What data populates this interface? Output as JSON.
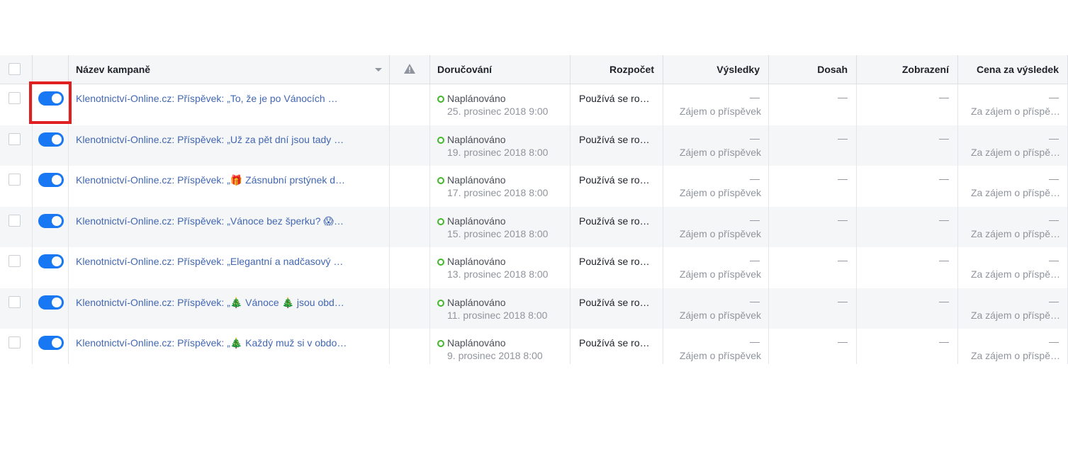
{
  "header": {
    "campaign_name": "Název kampaně",
    "delivery": "Doručování",
    "budget": "Rozpočet",
    "results": "Výsledky",
    "reach": "Dosah",
    "impressions": "Zobrazení",
    "cost_per_result": "Cena za výsledek"
  },
  "rows": [
    {
      "name": "Klenotnictví-Online.cz: Příspěvek: „To, že je po Vánocích …",
      "status": "Naplánováno",
      "date": "25. prosinec 2018 9:00",
      "budget": "Používá se ro…",
      "results": "—",
      "results_label": "Zájem o příspěvek",
      "reach": "—",
      "impressions": "—",
      "cost": "—",
      "cost_label": "Za zájem o příspě…"
    },
    {
      "name": "Klenotnictví-Online.cz: Příspěvek: „Už za pět dní jsou tady …",
      "status": "Naplánováno",
      "date": "19. prosinec 2018 8:00",
      "budget": "Používá se ro…",
      "results": "—",
      "results_label": "Zájem o příspěvek",
      "reach": "—",
      "impressions": "—",
      "cost": "—",
      "cost_label": "Za zájem o příspě…"
    },
    {
      "name": "Klenotnictví-Online.cz: Příspěvek: „🎁 Zásnubní prstýnek d…",
      "status": "Naplánováno",
      "date": "17. prosinec 2018 8:00",
      "budget": "Používá se ro…",
      "results": "—",
      "results_label": "Zájem o příspěvek",
      "reach": "—",
      "impressions": "—",
      "cost": "—",
      "cost_label": "Za zájem o příspě…"
    },
    {
      "name": "Klenotnictví-Online.cz: Příspěvek: „Vánoce bez šperku? 😱…",
      "status": "Naplánováno",
      "date": "15. prosinec 2018 8:00",
      "budget": "Používá se ro…",
      "results": "—",
      "results_label": "Zájem o příspěvek",
      "reach": "—",
      "impressions": "—",
      "cost": "—",
      "cost_label": "Za zájem o příspě…"
    },
    {
      "name": "Klenotnictví-Online.cz: Příspěvek: „Elegantní a nadčasový …",
      "status": "Naplánováno",
      "date": "13. prosinec 2018 8:00",
      "budget": "Používá se ro…",
      "results": "—",
      "results_label": "Zájem o příspěvek",
      "reach": "—",
      "impressions": "—",
      "cost": "—",
      "cost_label": "Za zájem o příspě…"
    },
    {
      "name": "Klenotnictví-Online.cz: Příspěvek: „🎄 Vánoce 🎄 jsou obd…",
      "status": "Naplánováno",
      "date": "11. prosinec 2018 8:00",
      "budget": "Používá se ro…",
      "results": "—",
      "results_label": "Zájem o příspěvek",
      "reach": "—",
      "impressions": "—",
      "cost": "—",
      "cost_label": "Za zájem o příspě…"
    },
    {
      "name": "Klenotnictví-Online.cz: Příspěvek: „🎄 Každý muž si v obdo…",
      "status": "Naplánováno",
      "date": "9. prosinec 2018 8:00",
      "budget": "Používá se ro…",
      "results": "—",
      "results_label": "Zájem o příspěvek",
      "reach": "—",
      "impressions": "—",
      "cost": "—",
      "cost_label": "Za zájem o příspě…"
    }
  ],
  "colors": {
    "accent": "#1877f2",
    "link": "#4267b2",
    "status_dot": "#42b72a",
    "highlight": "#e02020"
  },
  "icons": {
    "warning": "warning-triangle-icon",
    "sort": "sort-caret-icon"
  }
}
